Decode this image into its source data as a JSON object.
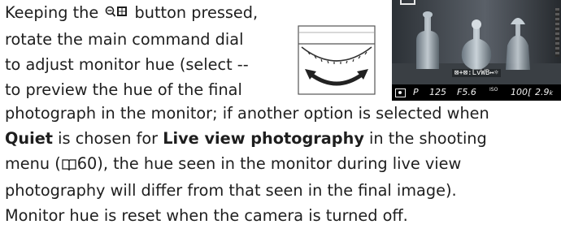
{
  "intro_lines": [
    [
      "Keeping the ",
      " button pressed,"
    ],
    "rotate the main command dial",
    "to adjust monitor hue (select --",
    "to preview the hue of the final"
  ],
  "body": {
    "line1": "photograph in the monitor; if another option is selected when",
    "quiet": "Quiet",
    "line2_mid": " is chosen for ",
    "live_view": "Live view photography",
    "line2_end": " in the shooting",
    "line3_start": "menu (",
    "page_ref": "60",
    "line3_end": "), the hue seen in the monitor during live view",
    "line4": "photography will differ from that seen in the final image).",
    "line5": "Monitor hue is reset when the camera is turned off."
  },
  "icons": {
    "zoom_out_button": "zoom-out-thumbnail-icon",
    "page_reference": "book-icon",
    "dial": "command-dial-icon"
  },
  "monitor": {
    "overlay_label": "⊠+⊠:LvWB↔☼",
    "status": {
      "mode": "P",
      "shutter": "125",
      "aperture": "F5.6",
      "iso_label": "ISO",
      "frames": "100[",
      "capacity": "2.9",
      "capacity_suffix": "k"
    }
  },
  "colors": {
    "text": "#1e1e1e",
    "monitor_bg": "#1a1c1f",
    "status_bar": "#000000"
  }
}
